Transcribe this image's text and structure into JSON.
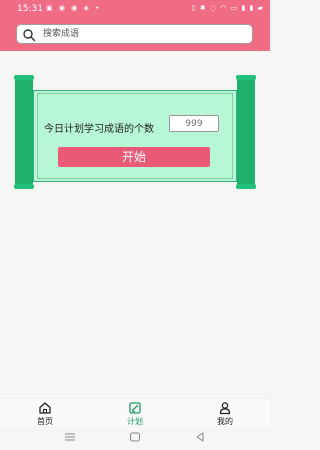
{
  "status_bar": {
    "time": "15:31"
  },
  "search": {
    "placeholder": "搜索成语"
  },
  "plan": {
    "label": "今日计划学习成语的个数",
    "count_placeholder": "999",
    "start_label": "开始"
  },
  "tabs": [
    {
      "label": "首页",
      "icon": "home-icon"
    },
    {
      "label": "计划",
      "icon": "plan-icon"
    },
    {
      "label": "我的",
      "icon": "profile-icon"
    }
  ],
  "colors": {
    "brand_pink": "#f06c85",
    "button": "#ea5a77",
    "scroll_green": "#1fb16c",
    "paper": "#b8f7d5",
    "active_tab": "#1a9d5c"
  }
}
